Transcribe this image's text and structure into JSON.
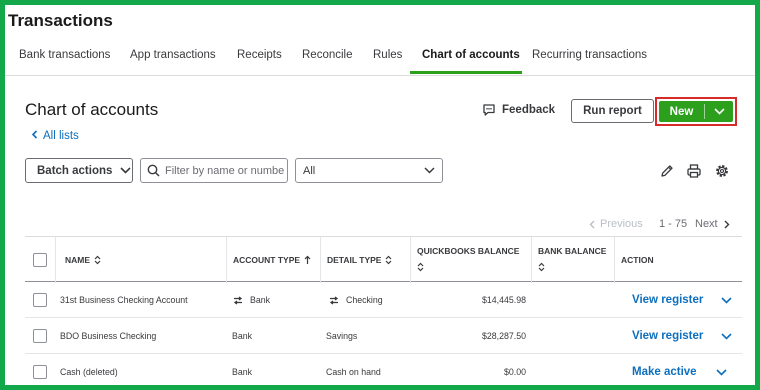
{
  "app_title": "Transactions",
  "tabs": [
    {
      "label": "Bank transactions"
    },
    {
      "label": "App transactions"
    },
    {
      "label": "Receipts"
    },
    {
      "label": "Reconcile"
    },
    {
      "label": "Rules"
    },
    {
      "label": "Chart of accounts",
      "active": true
    },
    {
      "label": "Recurring transactions"
    }
  ],
  "page": {
    "title": "Chart of accounts",
    "back_link": "All lists",
    "feedback": "Feedback",
    "run_report": "Run report",
    "new_button": "New"
  },
  "toolbar": {
    "batch_actions": "Batch actions",
    "search_placeholder": "Filter by name or number",
    "filter_value": "All"
  },
  "pagination": {
    "previous": "Previous",
    "range": "1 - 75",
    "next": "Next"
  },
  "table": {
    "columns": {
      "name": "NAME",
      "account_type": "ACCOUNT TYPE",
      "detail_type": "DETAIL TYPE",
      "quickbooks_balance": "QUICKBOOKS BALANCE",
      "bank_balance": "BANK BALANCE",
      "action": "ACTION"
    },
    "rows": [
      {
        "name": "31st Business Checking Account",
        "account_type": "Bank",
        "detail_type": "Checking",
        "qb_balance": "$14,445.98",
        "bank_balance": "",
        "action": "View register",
        "linked": true
      },
      {
        "name": "BDO Business Checking",
        "account_type": "Bank",
        "detail_type": "Savings",
        "qb_balance": "$28,287.50",
        "bank_balance": "",
        "action": "View register",
        "linked": false
      },
      {
        "name": "Cash (deleted)",
        "account_type": "Bank",
        "detail_type": "Cash on hand",
        "qb_balance": "$0.00",
        "bank_balance": "",
        "action": "Make active",
        "linked": false
      }
    ]
  },
  "colors": {
    "brand_green": "#2ca01c",
    "link_blue": "#0d6fbd",
    "highlight_red": "#d52b2b",
    "outer_border": "#13a84a"
  }
}
